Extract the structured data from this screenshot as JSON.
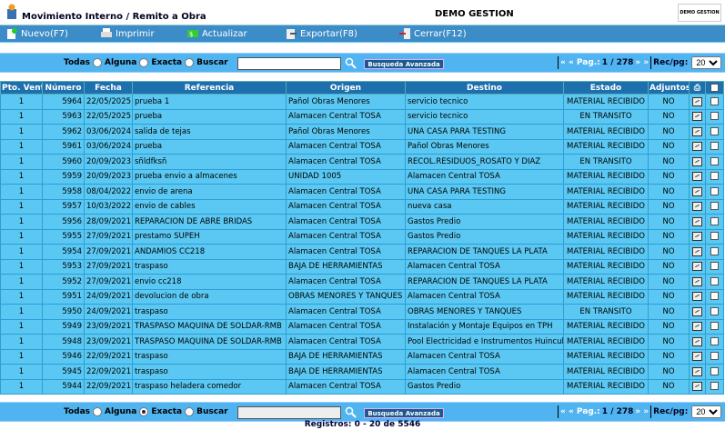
{
  "header": {
    "title": "Movimiento Interno / Remito a Obra",
    "company": "DEMO GESTION",
    "logo_text": "DEMO GESTION"
  },
  "toolbar": {
    "new_label": "Nuevo(F7)",
    "print_label": "Imprimir",
    "refresh_label": "Actualizar",
    "export_label": "Exportar(F8)",
    "close_label": "Cerrar(F12)"
  },
  "search": {
    "top_label": "Todas",
    "opt_any": "Alguna",
    "opt_exact": "Exacta",
    "opt_search": "Buscar",
    "value": "",
    "advanced_label": "Busqueda Avanzada",
    "top_selected": "todas",
    "bottom_selected": "alguna"
  },
  "pager": {
    "prefix": "« « Pag.:",
    "page": "1 / 278",
    "suffix": "» »",
    "per_page_label": "Rec/pg:",
    "per_page": "20"
  },
  "table": {
    "columns": [
      "Pto. Venta",
      "Número",
      "Fecha",
      "Referencia",
      "Origen",
      "Destino",
      "Estado",
      "Adjuntos"
    ],
    "rows": [
      [
        "1",
        "5964",
        "22/05/2025",
        "prueba 1",
        "Pañol Obras Menores",
        "servicio tecnico",
        "MATERIAL RECIBIDO",
        "NO"
      ],
      [
        "1",
        "5963",
        "22/05/2025",
        "prueba",
        "Alamacen Central TOSA",
        "servicio tecnico",
        "EN TRANSITO",
        "NO"
      ],
      [
        "1",
        "5962",
        "03/06/2024",
        "salida de tejas",
        "Pañol Obras Menores",
        "UNA CASA PARA TESTING",
        "MATERIAL RECIBIDO",
        "NO"
      ],
      [
        "1",
        "5961",
        "03/06/2024",
        "prueba",
        "Alamacen Central TOSA",
        "Pañol Obras Menores",
        "MATERIAL RECIBIDO",
        "NO"
      ],
      [
        "1",
        "5960",
        "20/09/2023",
        "sñldfksñ",
        "Alamacen Central TOSA",
        "RECOL.RESIDUOS_ROSATO Y DIAZ",
        "EN TRANSITO",
        "NO"
      ],
      [
        "1",
        "5959",
        "20/09/2023",
        "prueba envio a almacenes",
        "UNIDAD 1005",
        "Alamacen Central TOSA",
        "MATERIAL RECIBIDO",
        "NO"
      ],
      [
        "1",
        "5958",
        "08/04/2022",
        "envio de arena",
        "Alamacen Central TOSA",
        "UNA CASA PARA TESTING",
        "MATERIAL RECIBIDO",
        "NO"
      ],
      [
        "1",
        "5957",
        "10/03/2022",
        "envio de cables",
        "Alamacen Central TOSA",
        "nueva casa",
        "MATERIAL RECIBIDO",
        "NO"
      ],
      [
        "1",
        "5956",
        "28/09/2021",
        "REPARACION DE ABRE BRIDAS",
        "Alamacen Central TOSA",
        "Gastos Predio",
        "MATERIAL RECIBIDO",
        "NO"
      ],
      [
        "1",
        "5955",
        "27/09/2021",
        "prestamo SUPEH",
        "Alamacen Central TOSA",
        "Gastos Predio",
        "MATERIAL RECIBIDO",
        "NO"
      ],
      [
        "1",
        "5954",
        "27/09/2021",
        "ANDAMIOS CC218",
        "Alamacen Central TOSA",
        "REPARACION DE TANQUES LA PLATA",
        "MATERIAL RECIBIDO",
        "NO"
      ],
      [
        "1",
        "5953",
        "27/09/2021",
        "traspaso",
        "BAJA DE HERRAMIENTAS",
        "Alamacen Central TOSA",
        "MATERIAL RECIBIDO",
        "NO"
      ],
      [
        "1",
        "5952",
        "27/09/2021",
        "envio cc218",
        "Alamacen Central TOSA",
        "REPARACION DE TANQUES LA PLATA",
        "MATERIAL RECIBIDO",
        "NO"
      ],
      [
        "1",
        "5951",
        "24/09/2021",
        "devolucion de obra",
        "OBRAS MENORES Y TANQUES",
        "Alamacen Central TOSA",
        "MATERIAL RECIBIDO",
        "NO"
      ],
      [
        "1",
        "5950",
        "24/09/2021",
        "traspaso",
        "Alamacen Central TOSA",
        "OBRAS MENORES Y TANQUES",
        "EN TRANSITO",
        "NO"
      ],
      [
        "1",
        "5949",
        "23/09/2021",
        "TRASPASO MAQUINA DE SOLDAR-RMB",
        "Alamacen Central TOSA",
        "Instalación y Montaje Equipos en TPH",
        "MATERIAL RECIBIDO",
        "NO"
      ],
      [
        "1",
        "5948",
        "23/09/2021",
        "TRASPASO MAQUINA DE SOLDAR-RMB",
        "Alamacen Central TOSA",
        "Pool Electricidad e Instrumentos Huincul",
        "MATERIAL RECIBIDO",
        "NO"
      ],
      [
        "1",
        "5946",
        "22/09/2021",
        "traspaso",
        "BAJA DE HERRAMIENTAS",
        "Alamacen Central TOSA",
        "MATERIAL RECIBIDO",
        "NO"
      ],
      [
        "1",
        "5945",
        "22/09/2021",
        "traspaso",
        "BAJA DE HERRAMIENTAS",
        "Alamacen Central TOSA",
        "MATERIAL RECIBIDO",
        "NO"
      ],
      [
        "1",
        "5944",
        "22/09/2021",
        "traspaso heladera comedor",
        "Alamacen Central TOSA",
        "Gastos Predio",
        "MATERIAL RECIBIDO",
        "NO"
      ]
    ]
  },
  "footer": {
    "records": "Registros: 0 - 20 de 5546"
  }
}
